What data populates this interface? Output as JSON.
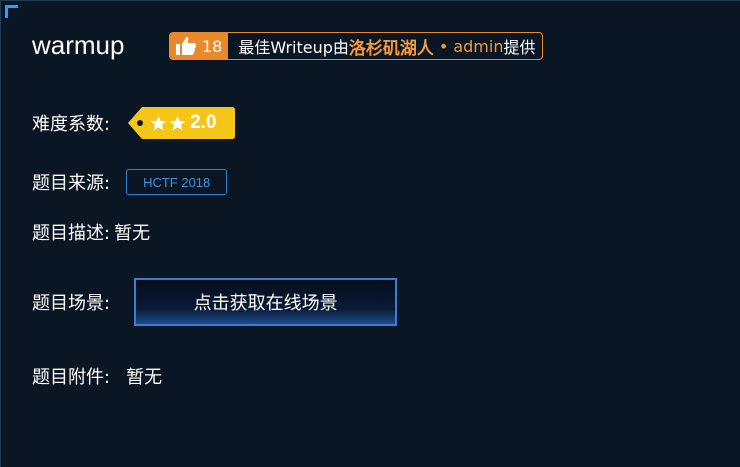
{
  "challenge": {
    "title": "warmup"
  },
  "writeup_badge": {
    "likes": "18",
    "prefix": "最佳Writeup由",
    "author": "洛杉矶湖人",
    "separator": "•",
    "admin": "admin",
    "suffix": "提供",
    "color": "#e88a2a"
  },
  "fields": {
    "difficulty_label": "难度系数:",
    "difficulty_value": "2.0",
    "source_label": "题目来源:",
    "source_value": "HCTF 2018",
    "description_label": "题目描述:",
    "description_value": "暂无",
    "scene_label": "题目场景:",
    "scene_button": "点击获取在线场景",
    "attachment_label": "题目附件:",
    "attachment_value": "暂无"
  },
  "colors": {
    "background": "#0b1624",
    "accent_blue": "#3b7fd1",
    "star_badge": "#f5c518"
  }
}
